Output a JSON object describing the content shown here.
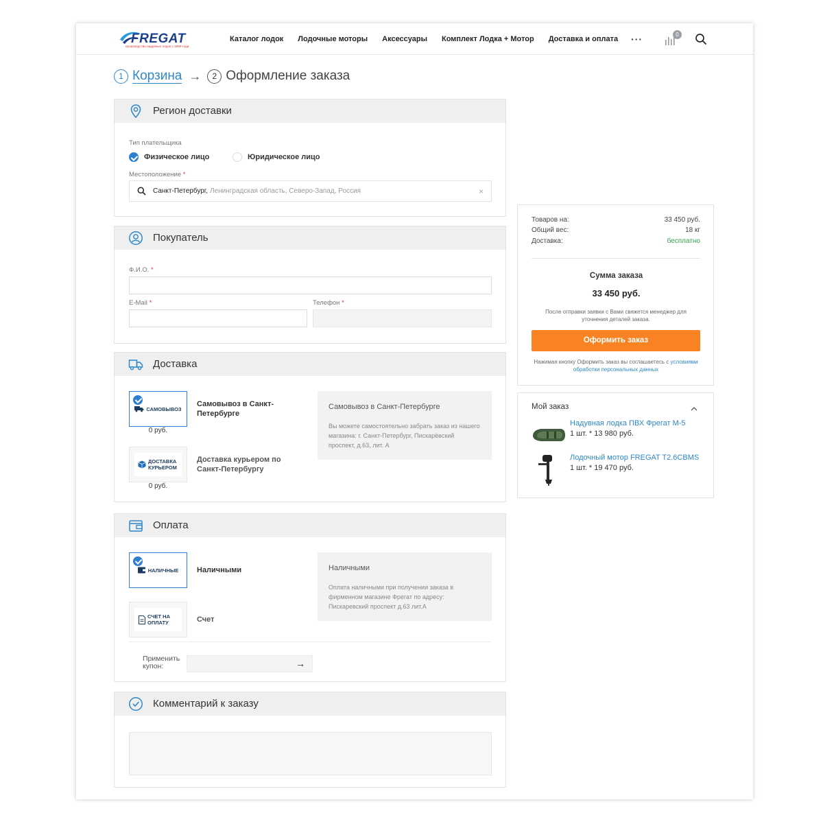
{
  "header": {
    "logo_text": "FREGAT",
    "logo_tagline": "производство надувных лодок с 1999 года",
    "nav": [
      "Каталог лодок",
      "Лодочные моторы",
      "Аксессуары",
      "Комплект Лодка + Мотор",
      "Доставка и оплата"
    ],
    "more": "···",
    "compare_count": "0"
  },
  "steps": [
    {
      "num": "1",
      "label": "Корзина"
    },
    {
      "num": "2",
      "label": "Оформление заказа"
    }
  ],
  "step_arrow": "→",
  "region": {
    "title": "Регион доставки",
    "payer_label": "Тип плательщика",
    "payer_options": [
      "Физическое лицо",
      "Юридическое лицо"
    ],
    "payer_selected": "Физическое лицо",
    "location_label": "Местоположение",
    "location_city": "Санкт-Петербург,",
    "location_region": "Ленинградская область, Северо-Запад, Россия",
    "clear": "×"
  },
  "buyer": {
    "title": "Покупатель",
    "fio_label": "Ф.И.О.",
    "email_label": "E-Mail",
    "phone_label": "Телефон",
    "required_mark": "*"
  },
  "delivery": {
    "title": "Доставка",
    "options": [
      {
        "card_text": "САМОВЫВОЗ",
        "price": "0 руб.",
        "name": "Самовывоз в Санкт-Петербурге",
        "selected": true
      },
      {
        "card_text": "ДОСТАВКА КУРЬЕРОМ",
        "price": "0 руб.",
        "name": "Доставка курьером по Санкт-Петербургу",
        "selected": false
      }
    ],
    "desc_title": "Самовывоз в Санкт-Петербурге",
    "desc_text": "Вы можете самостоятельно забрать заказ из нашего магазина: г. Санкт-Петербург, Пискарёвский проспект, д.63, лит. А"
  },
  "payment": {
    "title": "Оплата",
    "options": [
      {
        "card_text": "НАЛИЧНЫЕ",
        "name": "Наличными",
        "selected": true
      },
      {
        "card_text": "СЧЕТ НА ОПЛАТУ",
        "name": "Счет",
        "selected": false
      }
    ],
    "desc_title": "Наличными",
    "desc_text": "Оплата наличными при получении заказа в фирменном магазине Фрегат по адресу: Пискаревский проспект д.63 лит.А",
    "coupon_label": "Применить купон:",
    "coupon_go": "→"
  },
  "comment": {
    "title": "Комментарий к заказу"
  },
  "summary": {
    "rows": [
      {
        "label": "Товаров на:",
        "value": "33 450 руб."
      },
      {
        "label": "Общий вес:",
        "value": "18 кг"
      },
      {
        "label": "Доставка:",
        "value": "бесплатно"
      }
    ],
    "total_label": "Сумма заказа",
    "total_value": "33 450 руб.",
    "note": "После отправки заявки с Вами свяжется менеджер для уточнения деталей заказа.",
    "button": "Оформить заказ",
    "agree_text": "Нажимая кнопку Оформить заказ вы соглашаетесь с",
    "agree_link": "условиями обработки персональных данных"
  },
  "my_order": {
    "title": "Мой заказ",
    "items": [
      {
        "name": "Надувная лодка ПВХ Фрегат М-5",
        "qty": "1 шт. * 13 980 руб."
      },
      {
        "name": "Лодочный мотор FREGAT T2.6CBMS",
        "qty": "1 шт. * 19 470 руб."
      }
    ]
  },
  "colors": {
    "accent": "#2d87c8",
    "order_button": "#f98322",
    "free_delivery": "#33a24a",
    "section_header": "#efefef"
  }
}
